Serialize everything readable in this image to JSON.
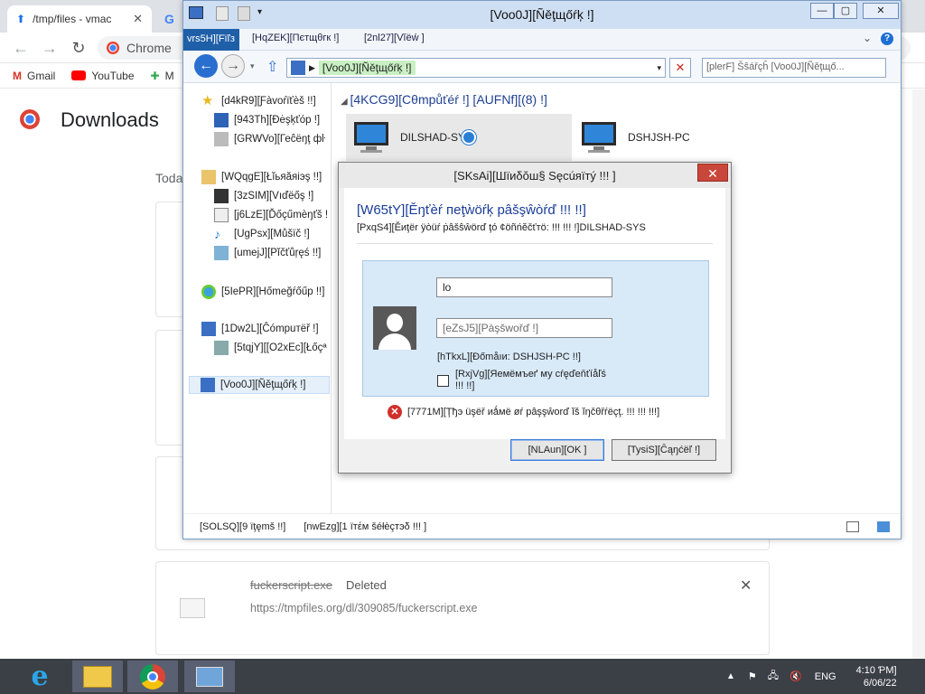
{
  "chrome": {
    "tabs": [
      {
        "title": "/tmp/files - vmac"
      }
    ],
    "tab2_letter": "G",
    "omnibox": "Chrome",
    "bookmarks": [
      "Gmail",
      "YouTube",
      "M"
    ]
  },
  "downloads": {
    "title": "Downloads",
    "today_label": "Toda",
    "item": {
      "name": "fuckerscript.exe",
      "status": "Deleted",
      "url": "https://tmpfiles.org/dl/309085/fuckerscript.exe"
    }
  },
  "explorer": {
    "title": "[Voo0J][Ñěţщőŕķ !]",
    "ribbon_tabs": [
      "vrs5H][Fïľз",
      "[HqZEK][Пєтщθгк !]",
      "[2nl27][Vĭёẃ ]"
    ],
    "address_segment": "[Voo0J][Ñěţщőŕķ !]",
    "search_placeholder": "[plerF] Šŝářçĥ [Voo0J][Ñěţщő...",
    "nav": {
      "favorites": "[d4kR9][Ƒàvoŕïťèš !!]",
      "desktop": "[943Th][Ðėşķťóp !]",
      "recent": "[GRWVo][Геĉёŋţ фŀ",
      "libraries": "[WQqgE][Łĭьяăяіэş !!]",
      "videos": "[3zSIM][Vıďёőş !]",
      "documents": "[j6LzE][Ďőçűmèŋťš !",
      "music": "[UgPsx][Můšïč !]",
      "pictures": "[umejJ][Pĭčťůŗęś !!]",
      "homegroup": "[5IePR][Hőmeğŕőűp !!]",
      "computer": "[1Dw2L][Ĉómpuтëř !]",
      "local_disk": "[5tqjY][[O2xEc][Łőçª",
      "network": "[Voo0J][Ñěţщőŕķ !]"
    },
    "group_header": "[4KCG9][Cθmpůťéŕ !] [AUFNf][(8) !]",
    "computers": [
      "DILSHAD-SYS",
      "DSHJSH-PC"
    ],
    "status": {
      "items": "[SOLSQ][9 ïţęmš !!]",
      "selected": "[nwEzg][1 ïтέм šéłèçтэδ !!! ]"
    }
  },
  "dialog": {
    "title": "[SKsAi][Шïиδŏш§ Sęcúяïтý !!! ]",
    "heading": "[W65tY][Ěŋťèŕ пеţẁöŕķ pâšşŵòŕď !!! !!]",
    "subheading": "[PxqS4][Ěиţër ÿòüŕ ṗâšŝŵörď ţó ¢öñńĕčťтö:  !!! !!! !]DILSHAD-SYS",
    "username_value": "lo",
    "password_placeholder": "[eZsJ5][Pàşšwořď !]",
    "domain_label": "[hTkxL][Ðőmåıи: DSHJSH-PC !!]",
    "remember_label": "[RxjVg][Яемёмъеґ му сŕęďеňťíåľś !!! !!]",
    "error": "[7771M][Ţђэ üşëř иǻмё øŕ pâşşŵorď ĭš ĭŋčθřŕëçţ. !!! !!! !!!]",
    "ok_label": "[NLAun][OK ]",
    "cancel_label": "[TysiS][Ĉąŋćёľ !]"
  },
  "taskbar": {
    "language": "ENG",
    "time": "4:10 ƤM]",
    "date": "6/06/22"
  }
}
